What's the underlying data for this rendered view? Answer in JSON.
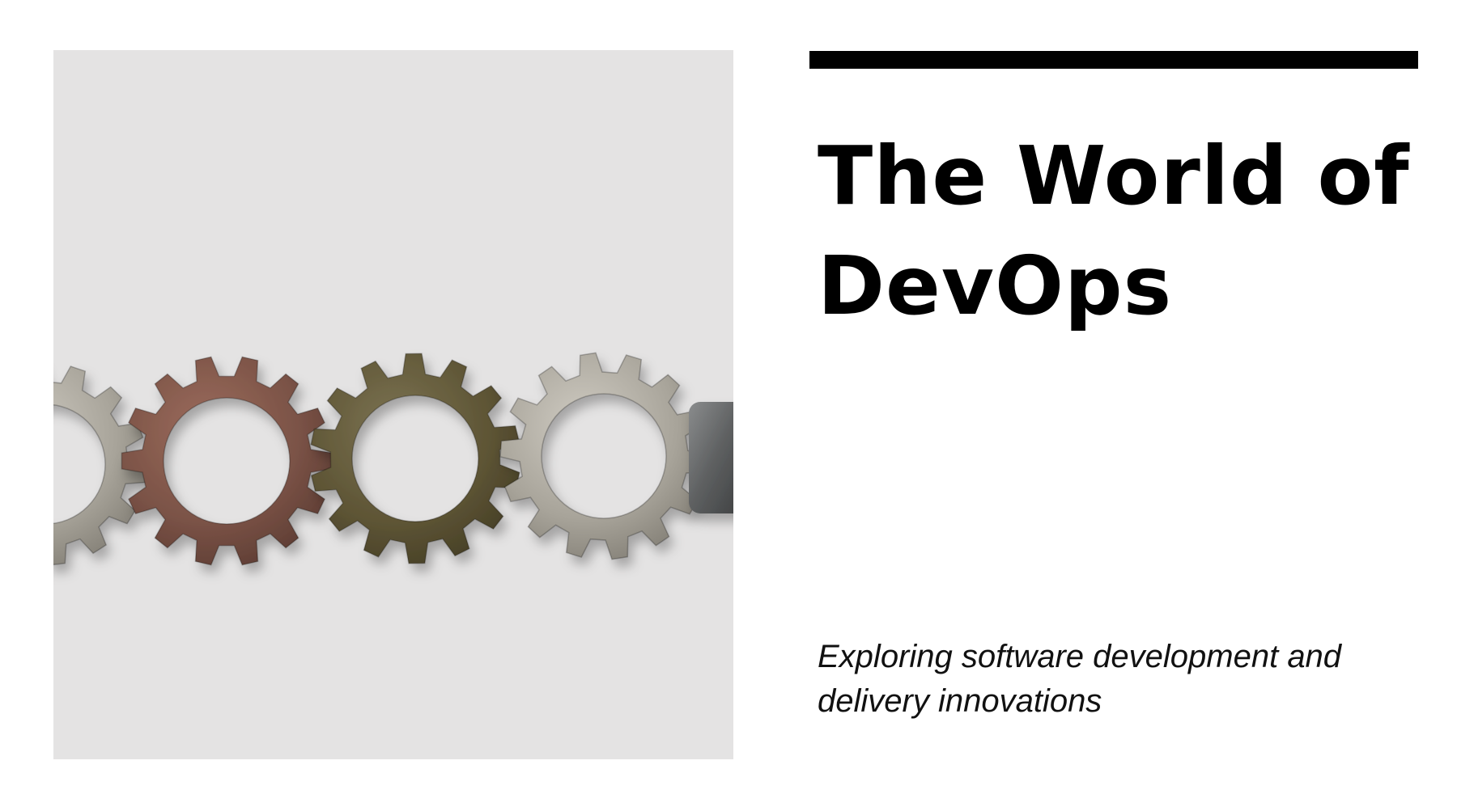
{
  "slide": {
    "title": "The World of DevOps",
    "subtitle": "Exploring software development and delivery innovations"
  },
  "image": {
    "subject": "gears-photo",
    "colors": {
      "background": "#e4e3e3",
      "gear_copper": "#7a5246",
      "gear_bronze": "#5e5535",
      "gear_silver": "#a8a49a",
      "block": "#5d5f60"
    }
  },
  "colors": {
    "rule": "#000000",
    "text": "#000000",
    "background": "#ffffff"
  }
}
